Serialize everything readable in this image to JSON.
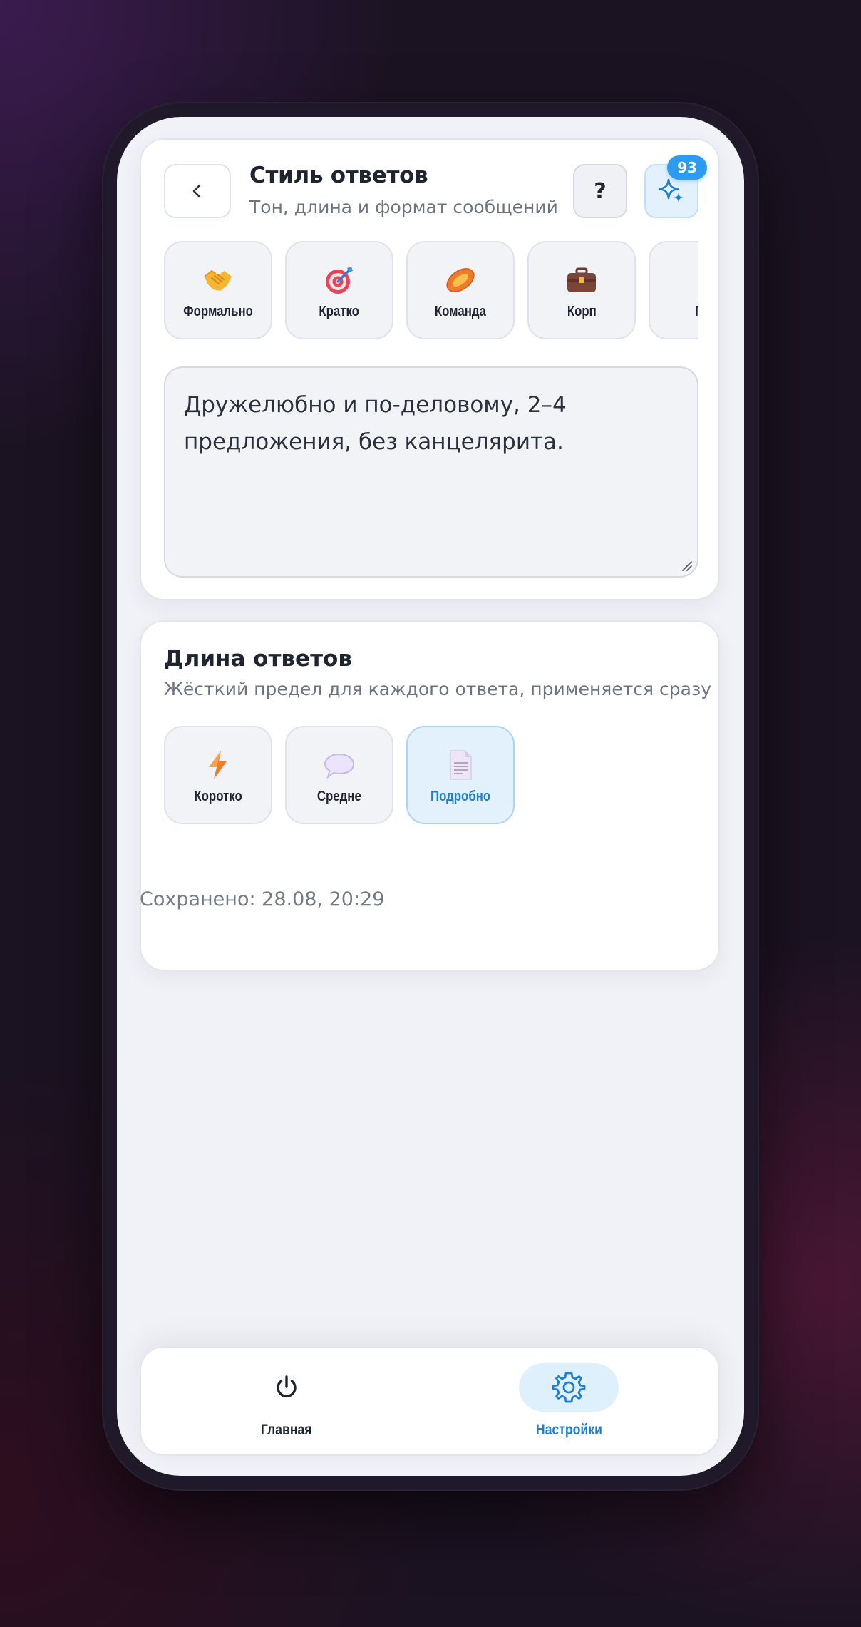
{
  "header": {
    "title": "Стиль ответов",
    "subtitle": "Тон, длина и формат сообщений",
    "help_label": "?",
    "badge_count": "93"
  },
  "style_presets": [
    {
      "label": "Формально",
      "icon": "handshake-icon"
    },
    {
      "label": "Кратко",
      "icon": "target-icon"
    },
    {
      "label": "Команда",
      "icon": "rugby-ball-icon"
    },
    {
      "label": "Корп",
      "icon": "briefcase-icon"
    },
    {
      "label": "Пр",
      "icon": "partial-icon"
    }
  ],
  "prompt": {
    "value": "Дружелюбно и по-деловому, 2–4 предложения, без канцелярита."
  },
  "length": {
    "title": "Длина ответов",
    "subtitle": "Жёсткий предел для каждого ответа, применяется сразу",
    "options": [
      {
        "label": "Коротко",
        "icon": "lightning-icon",
        "selected": false
      },
      {
        "label": "Средне",
        "icon": "speech-bubble-icon",
        "selected": false
      },
      {
        "label": "Подробно",
        "icon": "document-icon",
        "selected": true
      }
    ]
  },
  "saved_text": "Сохранено: 28.08, 20:29",
  "tabbar": {
    "home_label": "Главная",
    "settings_label": "Настройки"
  },
  "colors": {
    "accent": "#2d9cf0",
    "accent_text": "#1f7fcf",
    "selected_bg": "#e3f1fd"
  }
}
